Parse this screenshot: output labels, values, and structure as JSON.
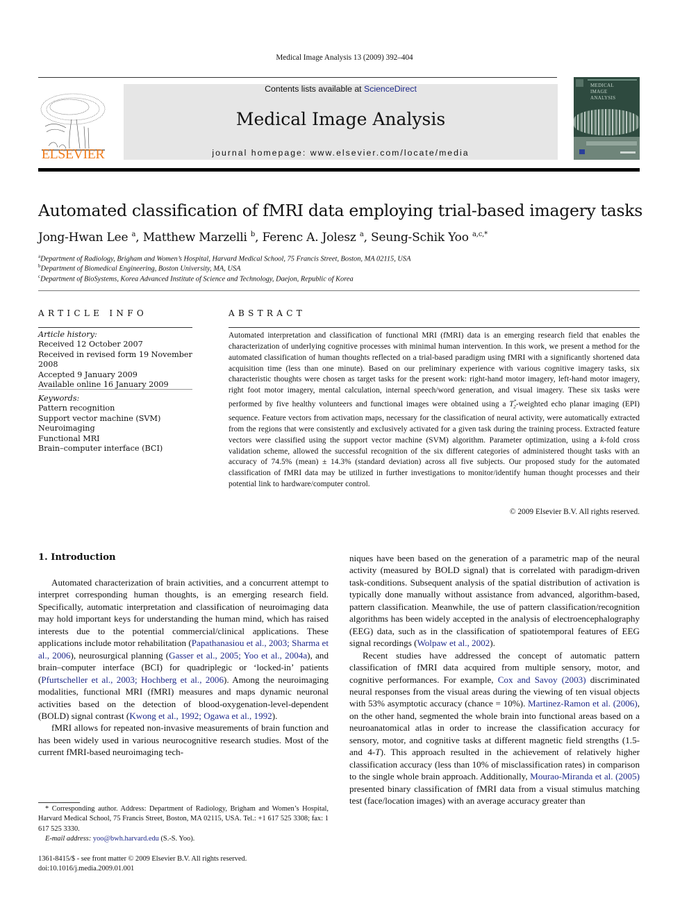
{
  "running_head": "Medical Image Analysis 13 (2009) 392–404",
  "banner": {
    "contents_prefix": "Contents lists available at ",
    "contents_link": "ScienceDirect",
    "journal_title": "Medical Image Analysis",
    "homepage": "journal homepage: www.elsevier.com/locate/media"
  },
  "logo": {
    "wordmark": "ELSEVIER",
    "color": "#f07e1e"
  },
  "cover": {
    "title_lines": [
      "MEDICAL",
      "IMAGE",
      "ANALYSIS"
    ],
    "color": "#2e4a3f"
  },
  "article": {
    "title": "Automated classification of fMRI data employing trial-based imagery tasks",
    "authors": [
      {
        "name": "Jong-Hwan Lee",
        "affil": "a"
      },
      {
        "name": "Matthew Marzelli",
        "affil": "b"
      },
      {
        "name": "Ferenc A. Jolesz",
        "affil": "a"
      },
      {
        "name": "Seung-Schik Yoo",
        "affil": "a,c,*"
      }
    ],
    "affiliations": [
      {
        "mark": "a",
        "text": "Department of Radiology, Brigham and Women’s Hospital, Harvard Medical School, 75 Francis Street, Boston, MA 02115, USA"
      },
      {
        "mark": "b",
        "text": "Department of Biomedical Engineering, Boston University, MA, USA"
      },
      {
        "mark": "c",
        "text": "Department of BioSystems, Korea Advanced Institute of Science and Technology, Daejon, Republic of Korea"
      }
    ]
  },
  "article_info": {
    "heading": "ARTICLE INFO",
    "history_label": "Article history:",
    "history": [
      "Received 12 October 2007",
      "Received in revised form 19 November 2008",
      "Accepted 9 January 2009",
      "Available online 16 January 2009"
    ],
    "keywords_label": "Keywords:",
    "keywords": [
      "Pattern recognition",
      "Support vector machine (SVM)",
      "Neuroimaging",
      "Functional MRI",
      "Brain–computer interface (BCI)"
    ]
  },
  "abstract": {
    "heading": "ABSTRACT",
    "text_1": "Automated interpretation and classification of functional MRI (fMRI) data is an emerging research field that enables the characterization of underlying cognitive processes with minimal human intervention. In this work, we present a method for the automated classification of human thoughts reflected on a trial-based paradigm using fMRI with a significantly shortened data acquisition time (less than one minute). Based on our preliminary experience with various cognitive imagery tasks, six characteristic thoughts were chosen as target tasks for the present work: right-hand motor imagery, left-hand motor imagery, right foot motor imagery, mental calculation, internal speech/word generation, and visual imagery. These six tasks were performed by five healthy volunteers and functional images were obtained using a ",
    "t2_symbol": "T",
    "t2_sup": "*",
    "t2_sub": "2",
    "text_2": "-weighted echo planar imaging (EPI) sequence. Feature vectors from activation maps, necessary for the classification of neural activity, were automatically extracted from the regions that were consistently and exclusively activated for a given task during the training process. Extracted feature vectors were classified using the support vector machine (SVM) algorithm. Parameter optimization, using a ",
    "k_symbol": "k",
    "text_3": "-fold cross validation scheme, allowed the successful recognition of the six different categories of administered thought tasks with an accuracy of 74.5% (mean) ± 14.3% (standard deviation) across all five subjects. Our proposed study for the automated classification of fMRI data may be utilized in further investigations to monitor/identify human thought processes and their potential link to hardware/computer control.",
    "copyright": "© 2009 Elsevier B.V. All rights reserved."
  },
  "introduction": {
    "heading": "1. Introduction",
    "p1": [
      {
        "t": "Automated characterization of brain activities, and a concurrent attempt to interpret corresponding human thoughts, is an emerging research field. Specifically, automatic interpretation and classification of neuroimaging data may hold important keys for understanding the human mind, which has raised interests due to the potential commercial/clinical applications. These applications include motor rehabilitation ("
      },
      {
        "link": "Papathanasiou et al., 2003; Sharma et al., 2006"
      },
      {
        "t": "), neurosurgical planning ("
      },
      {
        "link": "Gasser et al., 2005; Yoo et al., 2004a"
      },
      {
        "t": "), and brain–computer interface (BCI) for quadriplegic or ‘locked-in’ patients ("
      },
      {
        "link": "Pfurtscheller et al., 2003; Hochberg et al., 2006"
      },
      {
        "t": "). Among the neuroimaging modalities, functional MRI (fMRI) measures and maps dynamic neuronal activities based on the detection of blood-oxygenation-level-dependent (BOLD) signal contrast ("
      },
      {
        "link": "Kwong et al., 1992; Ogawa et al., 1992"
      },
      {
        "t": ")."
      }
    ],
    "p2": [
      {
        "t": "fMRI allows for repeated non-invasive measurements of brain function and has been widely used in various neurocognitive research studies. Most of the current fMRI-based neuroimaging techniques have been based on the generation of a parametric map of the neural activity (measured by BOLD signal) that is correlated with paradigm-driven task-conditions. Subsequent analysis of the spatial distribution of activation is typically done manually without assistance from advanced, algorithm-based, pattern classification. Meanwhile, the use of pattern classification/recognition algorithms has been widely accepted in the analysis of electroencephalography (EEG) data, such as in the classification of spatiotemporal features of EEG signal recordings ("
      },
      {
        "link": "Wolpaw et al., 2002"
      },
      {
        "t": ")."
      }
    ],
    "p3": [
      {
        "t": "Recent studies have addressed the concept of automatic pattern classification of fMRI data acquired from multiple sensory, motor, and cognitive performances. For example, "
      },
      {
        "link": "Cox and Savoy (2003)"
      },
      {
        "t": " discriminated neural responses from the visual areas during the viewing of ten visual objects with 53% asymptotic accuracy (chance = 10%). "
      },
      {
        "link": "Martinez-Ramon et al. (2006)"
      },
      {
        "t": ", on the other hand, segmented the whole brain into functional areas based on a neuroanatomical atlas in order to increase the classification accuracy for sensory, motor, and cognitive tasks at different magnetic field strengths (1.5- and 4-"
      },
      {
        "i": "T"
      },
      {
        "t": "). This approach resulted in the achievement of relatively higher classification accuracy (less than 10% of misclassification rates) in comparison to the single whole brain approach. Additionally, "
      },
      {
        "link": "Mourao-Miranda et al. (2005)"
      },
      {
        "t": " presented binary classification of fMRI data from a visual stimulus matching test (face/location images) with an average accuracy greater than"
      }
    ]
  },
  "footnote": {
    "corresponding": "* Corresponding author. Address: Department of Radiology, Brigham and Women’s Hospital, Harvard Medical School, 75 Francis Street, Boston, MA 02115, USA. Tel.: +1 617 525 3308; fax: 1 617 525 3330.",
    "email_label": "E-mail address: ",
    "email": "yoo@bwh.harvard.edu",
    "email_suffix": " (S.-S. Yoo)."
  },
  "front_matter": {
    "issn_line": "1361-8415/$ - see front matter © 2009 Elsevier B.V. All rights reserved.",
    "doi": "doi:10.1016/j.media.2009.01.001"
  }
}
